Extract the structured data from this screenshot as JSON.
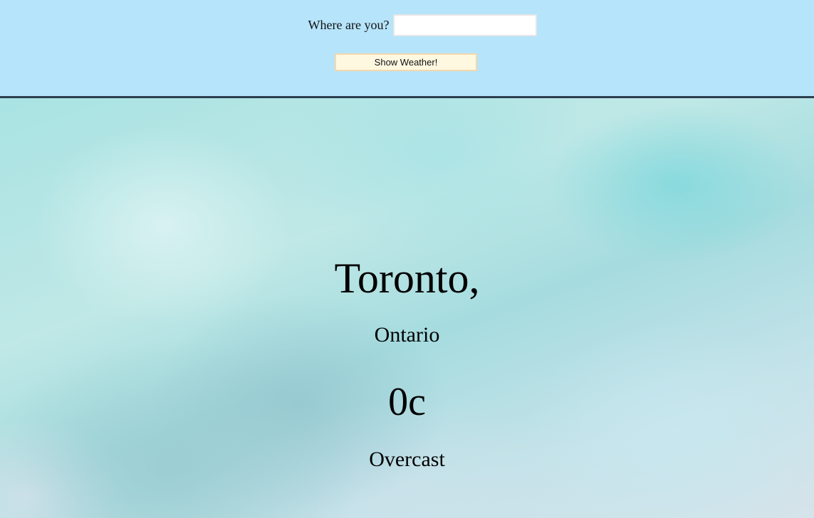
{
  "search": {
    "label": "Where are you?",
    "value": "",
    "placeholder": "",
    "button_label": "Show Weather!"
  },
  "weather": {
    "city": "Toronto,",
    "region": "Ontario",
    "temperature": "0c",
    "condition": "Overcast"
  },
  "colors": {
    "header_background": "#b6e4fb",
    "header_border": "#2c3e50",
    "button_background": "#fff8e1",
    "button_border": "#f5d9a8"
  }
}
